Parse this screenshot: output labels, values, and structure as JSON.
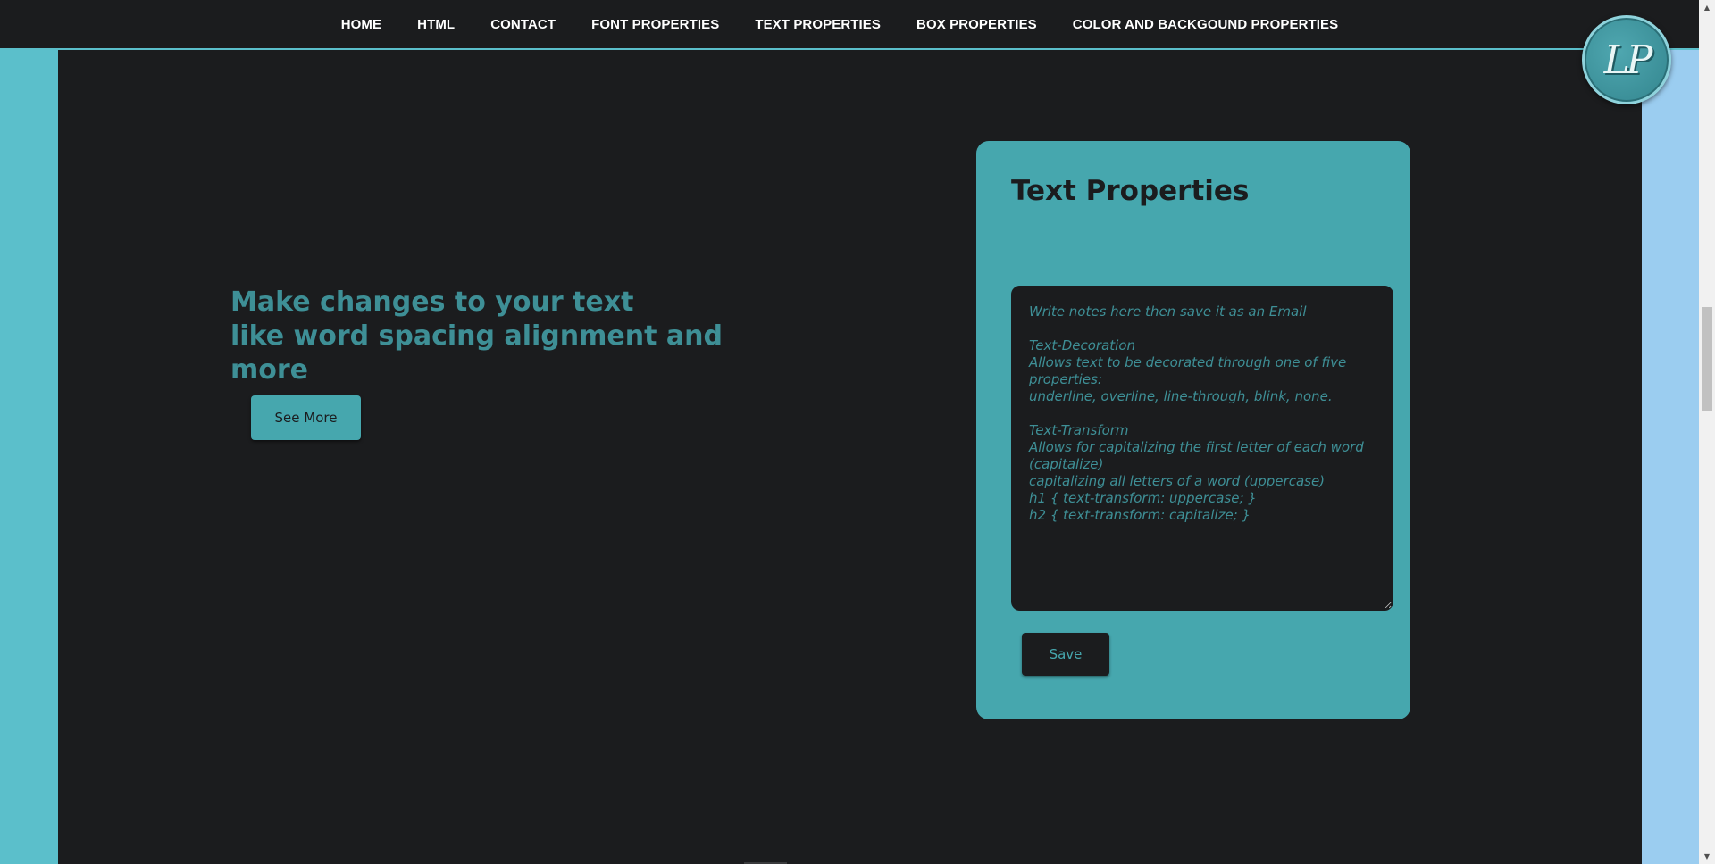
{
  "nav": {
    "items": [
      {
        "label": "HOME"
      },
      {
        "label": "HTML"
      },
      {
        "label": "CONTACT"
      },
      {
        "label": "FONT PROPERTIES"
      },
      {
        "label": "TEXT PROPERTIES"
      },
      {
        "label": "BOX PROPERTIES"
      },
      {
        "label": "COLOR AND BACKGOUND PROPERTIES"
      }
    ]
  },
  "logo": {
    "text": "LP"
  },
  "hero": {
    "line1": "Make changes to your text",
    "line2": "like word spacing alignment and more",
    "button_label": "See More"
  },
  "card": {
    "title": "Text Properties",
    "notes_placeholder": "Write notes here then save it as an Email\n\nText-Decoration\nAllows text to be decorated through one of five properties:\nunderline, overline, line-through, blink, none.\n\nText-Transform\nAllows for capitalizing the first letter of each word (capitalize)\ncapitalizing all letters of a word (uppercase)\nh1 { text-transform: uppercase; }\nh2 { text-transform: capitalize; }",
    "save_label": "Save"
  },
  "colors": {
    "accent": "#46a7ae",
    "background": "#1b1c1e",
    "left_panel": "#5bbfcb",
    "right_panel": "#9bcdf0",
    "hero_text": "#3e8f96"
  }
}
